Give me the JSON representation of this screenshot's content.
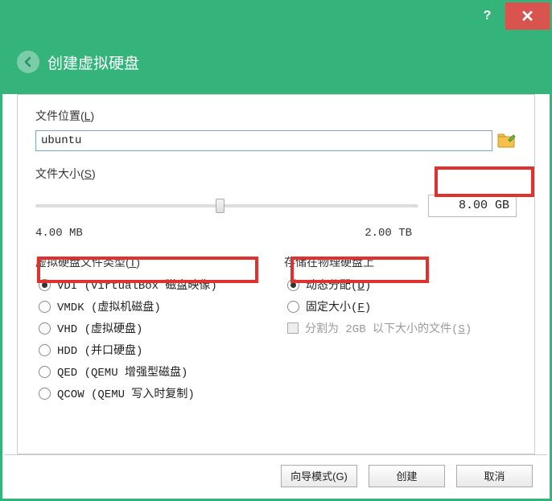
{
  "titlebar": {
    "help": "?",
    "close": "✕"
  },
  "header": {
    "title": "创建虚拟硬盘"
  },
  "location": {
    "label": "文件位置(",
    "accel": "L",
    "label_close": ")",
    "value": "ubuntu"
  },
  "size": {
    "label": "文件大小(",
    "accel": "S",
    "label_close": ")",
    "value": "8.00 GB",
    "min": "4.00 MB",
    "max": "2.00 TB"
  },
  "filetype": {
    "label": "虚拟硬盘文件类型(",
    "accel": "T",
    "label_close": ")",
    "options": [
      {
        "label": "VDI (VirtualBox 磁盘映像)",
        "checked": true
      },
      {
        "label": "VMDK (虚拟机磁盘)",
        "checked": false
      },
      {
        "label": "VHD (虚拟硬盘)",
        "checked": false
      },
      {
        "label": "HDD (并口硬盘)",
        "checked": false
      },
      {
        "label": "QED (QEMU 增强型磁盘)",
        "checked": false
      },
      {
        "label": "QCOW (QEMU 写入时复制)",
        "checked": false
      }
    ]
  },
  "storage": {
    "label": "存储在物理硬盘上",
    "options": [
      {
        "label": "动态分配(",
        "accel": "D",
        "close": ")",
        "checked": true
      },
      {
        "label": "固定大小(",
        "accel": "F",
        "close": ")",
        "checked": false
      }
    ],
    "split": {
      "label": "分割为 2GB 以下大小的文件(",
      "accel": "S",
      "close": ")"
    }
  },
  "footer": {
    "guided": "向导模式(G)",
    "create": "创建",
    "cancel": "取消"
  }
}
